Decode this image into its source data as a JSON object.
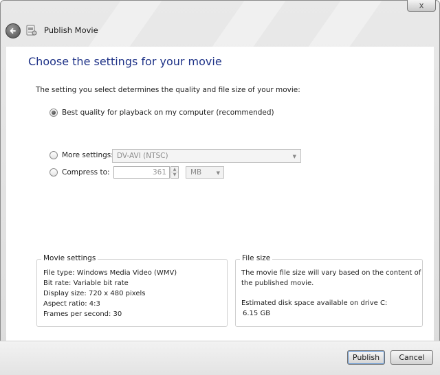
{
  "window": {
    "title": "Publish Movie",
    "close_glyph": "x"
  },
  "main": {
    "heading": "Choose the settings for your movie",
    "description": "The setting you select determines the quality and file size of your movie:"
  },
  "options": {
    "best_label": "Best quality for playback on my computer (recommended)",
    "compress_label": "Compress to:",
    "compress_value": "361",
    "compress_unit": "MB",
    "more_label": "More settings:",
    "more_value": "DV-AVI (NTSC)",
    "selected": "best"
  },
  "movie_settings": {
    "title": "Movie settings",
    "lines": [
      "File type: Windows Media Video (WMV)",
      "Bit rate: Variable bit rate",
      "Display size: 720 x 480 pixels",
      "Aspect ratio: 4:3",
      "Frames per second: 30"
    ]
  },
  "file_size": {
    "title": "File size",
    "note": "The movie file size will vary based on the content of the published movie.",
    "disk_label": "Estimated disk space available on drive C:",
    "disk_value": "6.15 GB"
  },
  "buttons": {
    "publish": "Publish",
    "cancel": "Cancel"
  },
  "icons": {
    "back": "back-arrow-icon",
    "app": "movie-publish-icon",
    "close": "close-icon"
  },
  "colors": {
    "heading": "#1e3287",
    "disabled_text": "#9a9a9a"
  }
}
